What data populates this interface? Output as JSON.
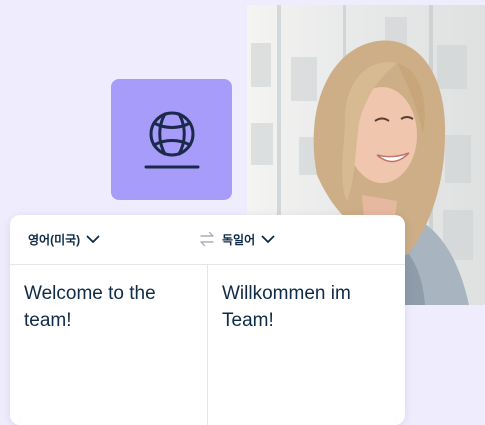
{
  "translator": {
    "source_language": "영어(미국)",
    "target_language": "독일어",
    "source_text": "Welcome to the team!",
    "target_text": "Willkommen im Team!"
  },
  "icons": {
    "tile_icon": "globe-stand-icon",
    "source_dropdown": "chevron-down-icon",
    "target_dropdown": "chevron-down-icon",
    "swap": "swap-arrows-icon"
  },
  "colors": {
    "background": "#efedfd",
    "tile": "#a89cfa",
    "icon_stroke": "#1b2a4a",
    "text": "#0f2b46",
    "divider": "#e4e6ec"
  }
}
